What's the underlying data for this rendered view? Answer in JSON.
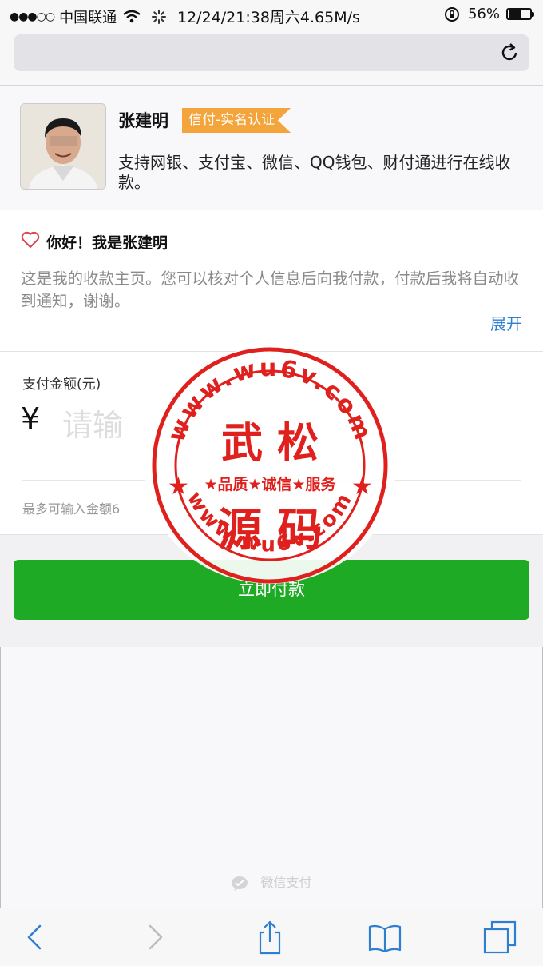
{
  "status_bar": {
    "signal": "●●●○○",
    "carrier": "中国联通",
    "datetime": "12/24/21:38周六4.65M/s",
    "battery": "56%"
  },
  "profile": {
    "name": "张建明",
    "badge": "信付-实名认证",
    "description": "支持网银、支付宝、微信、QQ钱包、财付通进行在线收款。"
  },
  "greeting": {
    "title": "你好！我是张建明",
    "text": "这是我的收款主页。您可以核对个人信息后向我付款，付款后我将自动收到通知，谢谢。",
    "expand_label": "展开"
  },
  "payment": {
    "amount_label": "支付金额(元)",
    "currency": "¥",
    "placeholder": "请输",
    "limit_text": "最多可输入金额6",
    "button_label": "立即付款"
  },
  "watermark": {
    "url_top": "www.wu6v.com",
    "url_bottom": "www.wu6v.com",
    "title_top": "武 松",
    "title_bottom": "源 码",
    "slogan": "★品质★诚信★服务"
  },
  "footer": {
    "brand": "微信支付"
  },
  "colors": {
    "accent_green": "#1eaa24",
    "badge_orange": "#f3a43a",
    "link_blue": "#2f7fd1",
    "stamp_red": "#e0201d"
  }
}
